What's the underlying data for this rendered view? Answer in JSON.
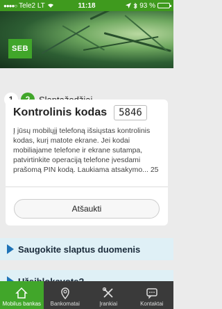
{
  "status_bar": {
    "carrier": "Tele2 LT",
    "time": "11:18",
    "battery": "93 %",
    "battery_level": 0.93
  },
  "brand": {
    "logo_text": "SEB"
  },
  "steps": {
    "first": "1",
    "current": "2",
    "current_label": "Slaptažodžiai"
  },
  "verification": {
    "title": "Kontrolinis kodas",
    "code": "5846",
    "description": "Į jūsų mobilųjį telefoną išsiųstas kontrolinis kodas, kurį matote ekrane. Jei kodai mobiliajame telefone ir ekrane sutampa, patvirtinkite operaciją telefone įvesdami prašomą PIN kodą. Laukiama atsakymo... 25",
    "cancel_label": "Atšaukti"
  },
  "info": {
    "item1": "Saugokite slaptus duomenis",
    "item2": "Užsiblokavote?"
  },
  "tabs": {
    "home": "Mobilus bankas",
    "atm": "Bankomatai",
    "tools": "Įrankiai",
    "contacts": "Kontaktai"
  },
  "colors": {
    "brand_green": "#41a62a",
    "info_bg": "#dff0f6",
    "arrow_blue": "#1e73b7",
    "tabbar_bg": "#3a3a3a"
  }
}
